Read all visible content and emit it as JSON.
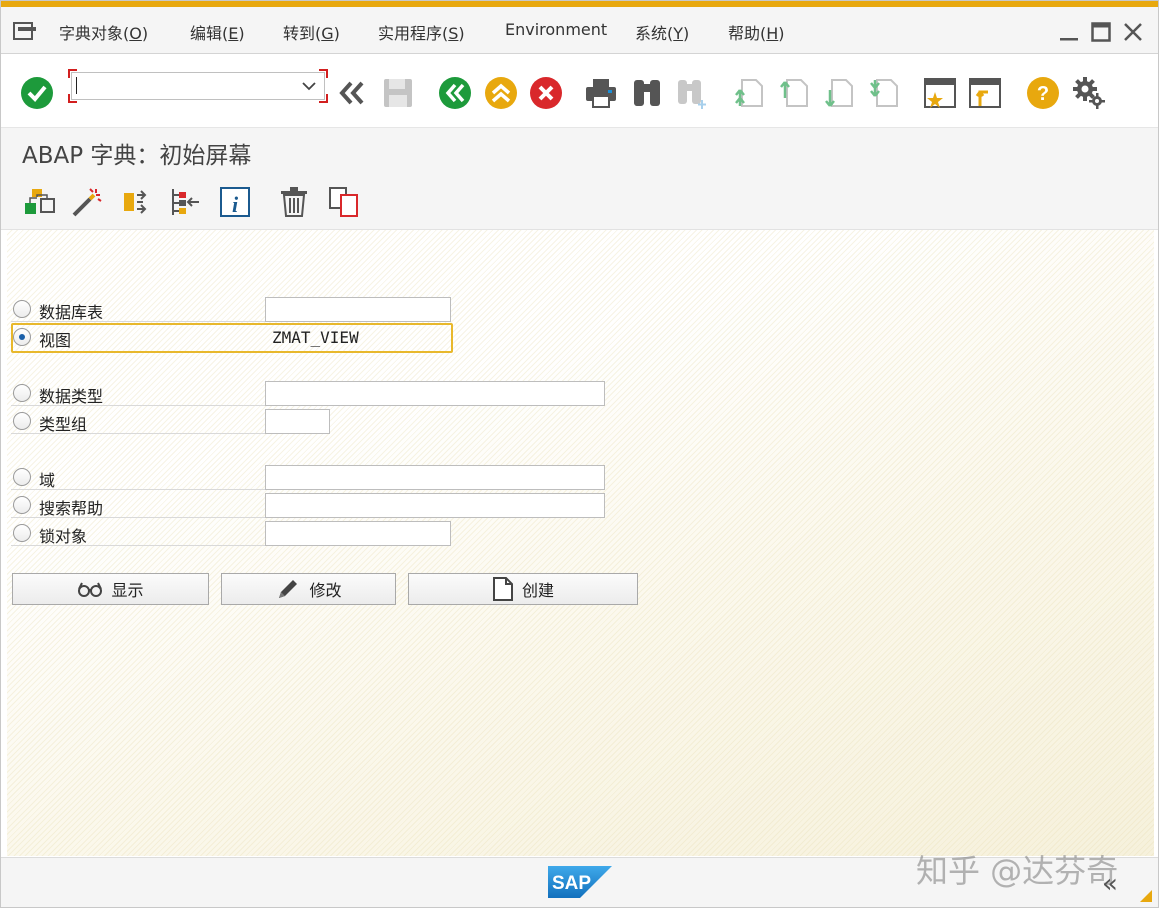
{
  "menu": {
    "items": [
      {
        "label": "字典对象(O)",
        "key": "O"
      },
      {
        "label": "编辑(E)",
        "key": "E"
      },
      {
        "label": "转到(G)",
        "key": "G"
      },
      {
        "label": "实用程序(S)",
        "key": "S"
      },
      {
        "label": "Environment",
        "key": ""
      },
      {
        "label": "系统(Y)",
        "key": "Y"
      },
      {
        "label": "帮助(H)",
        "key": "H"
      }
    ]
  },
  "toolbar": {
    "command_field_value": ""
  },
  "title": "ABAP 字典：初始屏幕",
  "form": {
    "selected": "view",
    "rows": [
      {
        "id": "db-table",
        "label": "数据库表",
        "value": ""
      },
      {
        "id": "view",
        "label": "视图",
        "value": "ZMAT_VIEW"
      },
      {
        "id": "data-type",
        "label": "数据类型",
        "value": ""
      },
      {
        "id": "type-group",
        "label": "类型组",
        "value": ""
      },
      {
        "id": "domain",
        "label": "域",
        "value": ""
      },
      {
        "id": "search-help",
        "label": "搜索帮助",
        "value": ""
      },
      {
        "id": "lock-object",
        "label": "锁对象",
        "value": ""
      }
    ]
  },
  "buttons": {
    "display": "显示",
    "change": "修改",
    "create": "创建"
  },
  "status": {
    "brand": "SAP",
    "watermark": "知乎 @达芬奇"
  },
  "colors": {
    "accent": "#e8a80e",
    "focus": "#e8b82c",
    "ok_green": "#1d9a3b",
    "cancel_red": "#d9282b",
    "sap_blue": "#1b8ed6"
  }
}
